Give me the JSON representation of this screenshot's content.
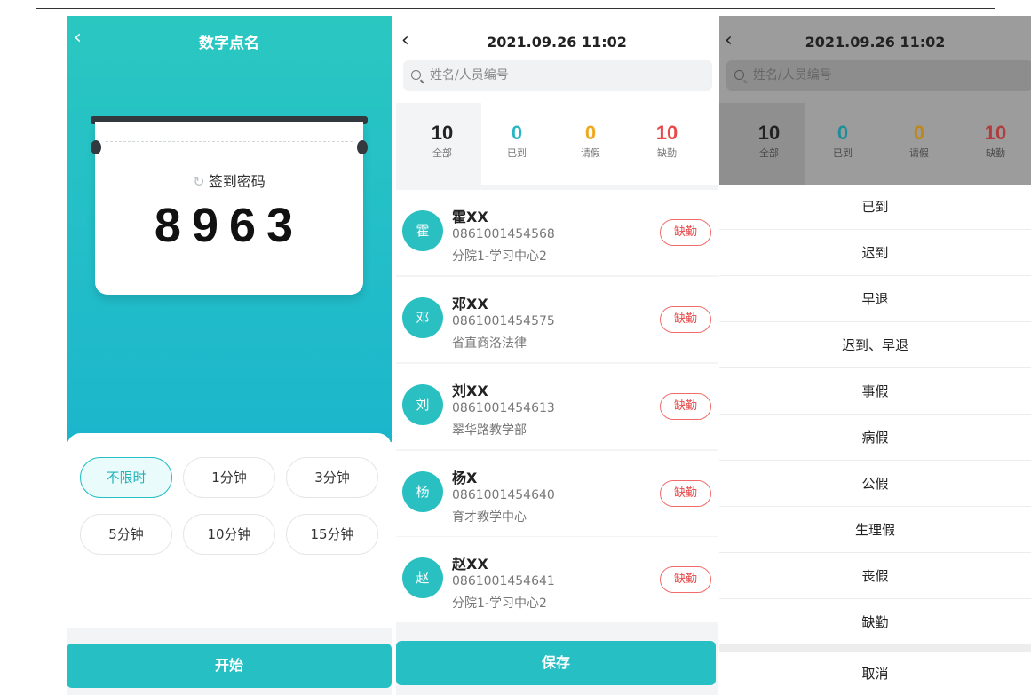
{
  "screen1": {
    "title": "数字点名",
    "password_label": "签到密码",
    "code": "8963",
    "durations": [
      "不限时",
      "1分钟",
      "3分钟",
      "5分钟",
      "10分钟",
      "15分钟"
    ],
    "active_duration": "不限时",
    "start_label": "开始",
    "accent_color": "#25bfc4"
  },
  "screen2": {
    "datetime": "2021.09.26 11:02",
    "search_placeholder": "姓名/人员编号",
    "stats": [
      {
        "num": "10",
        "label": "全部",
        "color": "#222222"
      },
      {
        "num": "0",
        "label": "已到",
        "color": "#2ab7c4"
      },
      {
        "num": "0",
        "label": "请假",
        "color": "#f0a81e"
      },
      {
        "num": "10",
        "label": "缺勤",
        "color": "#e84a4a"
      }
    ],
    "people": [
      {
        "avatar": "霍",
        "name": "霍XX",
        "code": "0861001454568",
        "dept": "分院1-学习中心2",
        "status": "缺勤"
      },
      {
        "avatar": "邓",
        "name": "邓XX",
        "code": "0861001454575",
        "dept": "省直商洛法律",
        "status": "缺勤"
      },
      {
        "avatar": "刘",
        "name": "刘XX",
        "code": "0861001454613",
        "dept": "翠华路教学部",
        "status": "缺勤"
      },
      {
        "avatar": "杨",
        "name": "杨X",
        "code": "0861001454640",
        "dept": "育才教学中心",
        "status": "缺勤"
      },
      {
        "avatar": "赵",
        "name": "赵XX",
        "code": "0861001454641",
        "dept": "分院1-学习中心2",
        "status": "缺勤"
      }
    ],
    "save_label": "保存"
  },
  "screen3": {
    "datetime": "2021.09.26 11:02",
    "search_placeholder": "姓名/人员编号",
    "stats": [
      {
        "num": "10",
        "label": "全部",
        "color": "#222222"
      },
      {
        "num": "0",
        "label": "已到",
        "color": "#1d8e99"
      },
      {
        "num": "0",
        "label": "请假",
        "color": "#c0861a"
      },
      {
        "num": "10",
        "label": "缺勤",
        "color": "#b23c3c"
      }
    ],
    "options": [
      "已到",
      "迟到",
      "早退",
      "迟到、早退",
      "事假",
      "病假",
      "公假",
      "生理假",
      "丧假",
      "缺勤"
    ],
    "cancel_label": "取消"
  }
}
